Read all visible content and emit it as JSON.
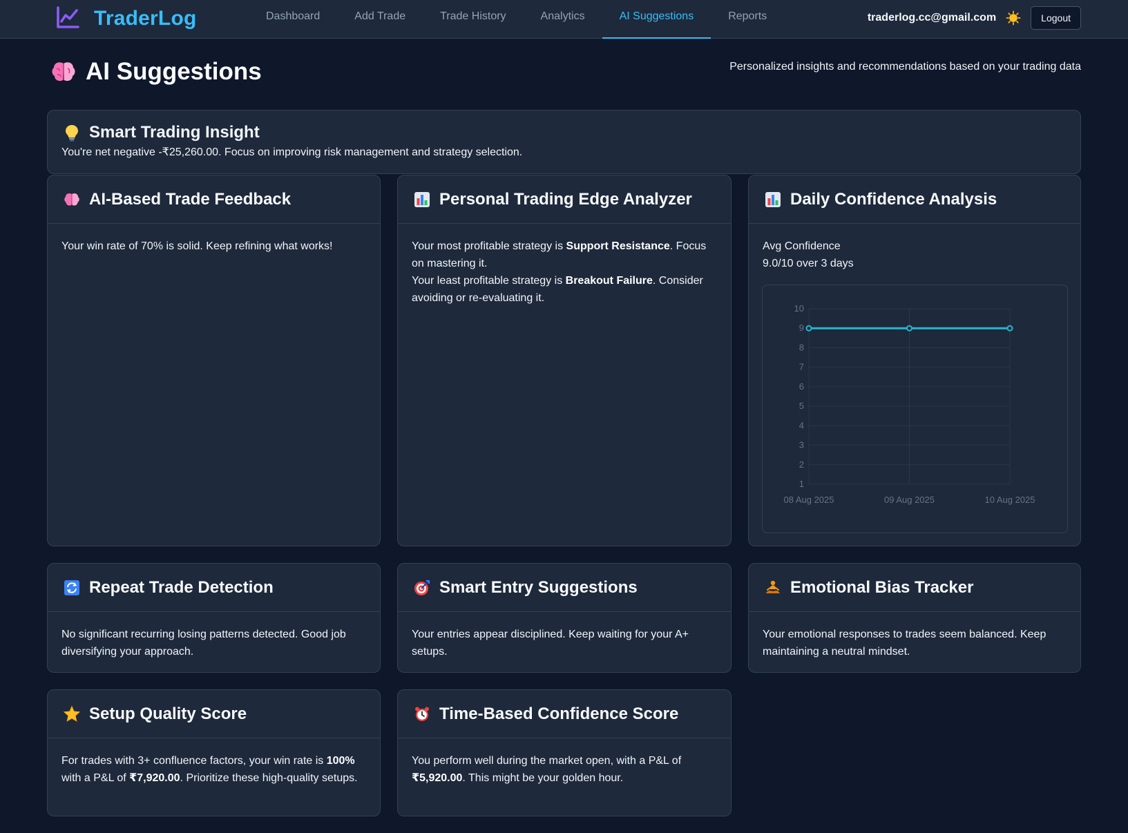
{
  "app": {
    "name": "TraderLog"
  },
  "nav": {
    "links": [
      "Dashboard",
      "Add Trade",
      "Trade History",
      "Analytics",
      "AI Suggestions",
      "Reports"
    ],
    "active": "AI Suggestions",
    "email": "traderlog.cc@gmail.com",
    "logout_label": "Logout"
  },
  "page": {
    "title": "AI Suggestions",
    "subtitle": "Personalized insights and recommendations based on your trading data"
  },
  "insight": {
    "title": "Smart Trading Insight",
    "text": "You're net negative -₹25,260.00. Focus on improving risk management and strategy selection."
  },
  "feedback": {
    "title": "AI-Based Trade Feedback",
    "text": "Your win rate of 70% is solid. Keep refining what works!"
  },
  "edge": {
    "title": "Personal Trading Edge Analyzer",
    "line1_pre": "Your most profitable strategy is ",
    "most_profitable": "Support Resistance",
    "line1_post": ". Focus on mastering it.",
    "line2_pre": "Your least profitable strategy is ",
    "least_profitable": "Breakout Failure",
    "line2_post": ". Consider avoiding or re-evaluating it."
  },
  "confidence": {
    "title": "Daily Confidence Analysis",
    "label": "Avg Confidence",
    "summary": "9.0/10 over 3 days"
  },
  "chart_data": {
    "type": "line",
    "x": [
      "08 Aug 2025",
      "09 Aug 2025",
      "10 Aug 2025"
    ],
    "series": [
      {
        "values": [
          9,
          9,
          9
        ],
        "color": "#22b8cf"
      }
    ],
    "ylim": [
      1,
      10
    ],
    "yticks": [
      1,
      2,
      3,
      4,
      5,
      6,
      7,
      8,
      9,
      10
    ],
    "grid": true,
    "title": "",
    "xlabel": "",
    "ylabel": ""
  },
  "repeat": {
    "title": "Repeat Trade Detection",
    "text": "No significant recurring losing patterns detected. Good job diversifying your approach."
  },
  "entry": {
    "title": "Smart Entry Suggestions",
    "text": "Your entries appear disciplined. Keep waiting for your A+ setups."
  },
  "emotion": {
    "title": "Emotional Bias Tracker",
    "text": "Your emotional responses to trades seem balanced. Keep maintaining a neutral mindset."
  },
  "setup": {
    "title": "Setup Quality Score",
    "pre": "For trades with 3+ confluence factors, your win rate is ",
    "win_rate": "100%",
    "mid": " with a P&L of ",
    "pnl": "₹7,920.00",
    "post": ". Prioritize these high-quality setups."
  },
  "time": {
    "title": "Time-Based Confidence Score",
    "pre": "You perform well during the market open, with a P&L of ",
    "pnl": "₹5,920.00",
    "post": ". This might be your golden hour."
  },
  "icons": {
    "logo": "chart-line-icon",
    "theme": "sun-icon",
    "brain": "brain-icon",
    "bulb": "lightbulb-icon",
    "bars": "bar-chart-icon",
    "repeat": "repeat-icon",
    "target": "target-icon",
    "meditation": "meditation-icon",
    "star": "star-icon",
    "alarm": "alarm-clock-icon"
  },
  "colors": {
    "accent": "#38bdf8",
    "background": "#0f172a",
    "card": "#1e293b",
    "line": "#22b8cf"
  }
}
